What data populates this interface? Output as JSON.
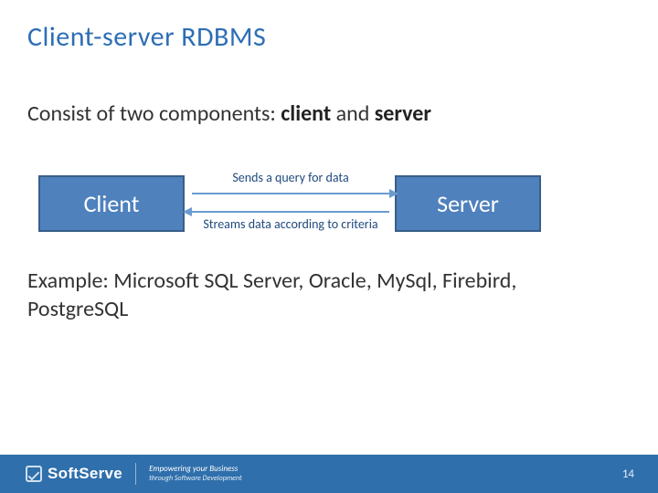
{
  "title": "Client-server RDBMS",
  "intro": {
    "prefix": "Consist of two components: ",
    "b1": "client",
    "mid": " and ",
    "b2": "server"
  },
  "diagram": {
    "client_label": "Client",
    "server_label": "Server",
    "arrow_top_label": "Sends a query for data",
    "arrow_bot_label": "Streams data according to criteria"
  },
  "example": "Example: Microsoft SQL Server, Oracle, MySql, Firebird, PostgreSQL",
  "footer": {
    "brand": "SoftServe",
    "tag1": "Empowering your Business",
    "tag2": "through Software Development",
    "page": "14"
  }
}
